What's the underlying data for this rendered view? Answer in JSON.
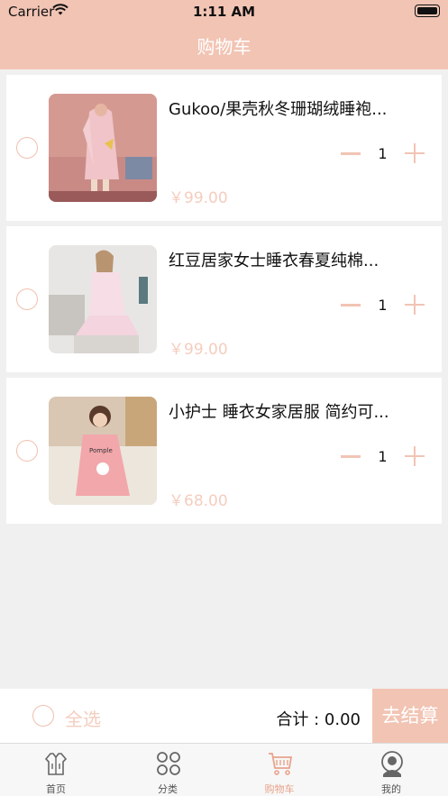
{
  "status_bar": {
    "carrier": "Carrier",
    "time": "1:11 AM"
  },
  "header": {
    "title": "购物车"
  },
  "cart_items": [
    {
      "title": "Gukoo/果壳秋冬珊瑚绒睡袍...",
      "quantity": "1",
      "price": "￥99.00"
    },
    {
      "title": "红豆居家女士睡衣春夏纯棉...",
      "quantity": "1",
      "price": "￥99.00"
    },
    {
      "title": "小护士 睡衣女家居服 简约可...",
      "quantity": "1",
      "price": "￥68.00"
    }
  ],
  "checkout": {
    "select_all": "全选",
    "total": "合计 : 0.00",
    "button": "去结算"
  },
  "tabbar": {
    "items": [
      {
        "label": "首页",
        "icon": "home-icon"
      },
      {
        "label": "分类",
        "icon": "category-icon"
      },
      {
        "label": "购物车",
        "icon": "cart-icon",
        "active": true
      },
      {
        "label": "我的",
        "icon": "profile-icon"
      }
    ]
  },
  "colors": {
    "accent": "#f2c4b4",
    "price": "#f4cdbf"
  }
}
